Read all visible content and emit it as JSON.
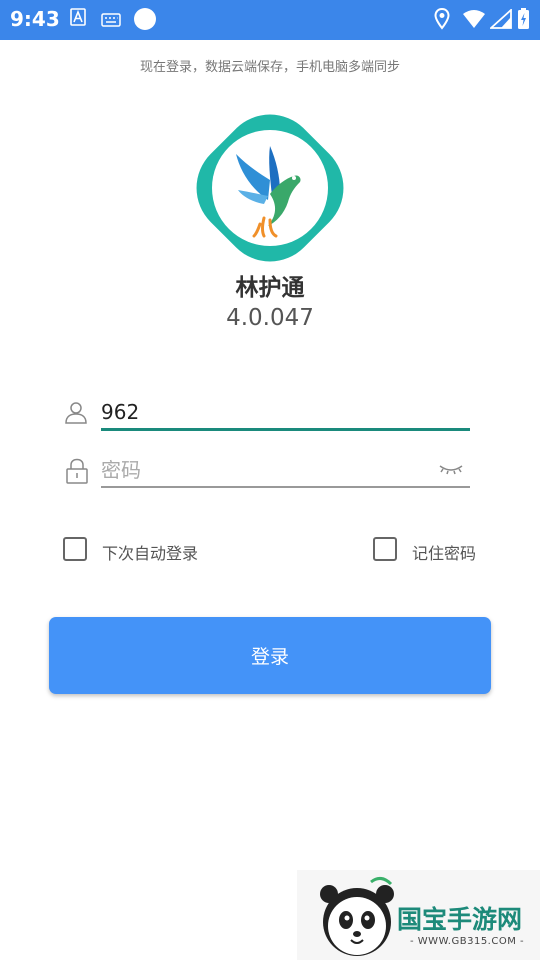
{
  "status_bar": {
    "time": "9:43"
  },
  "header": {
    "subtitle": "现在登录，数据云端保存，手机电脑多端同步"
  },
  "app": {
    "name": "林护通",
    "version": "4.0.047"
  },
  "form": {
    "username_value": "962",
    "password_placeholder": "密码"
  },
  "options": {
    "auto_login_label": "下次自动登录",
    "remember_password_label": "记住密码"
  },
  "login_button_label": "登录",
  "watermark": {
    "title": "国宝手游网",
    "url": "- WWW.GB315.COM -"
  },
  "colors": {
    "status_bar": "#3b86ea",
    "accent": "#4493f8",
    "logo_teal": "#20b8a8",
    "active_underline": "#1a8a7c"
  }
}
